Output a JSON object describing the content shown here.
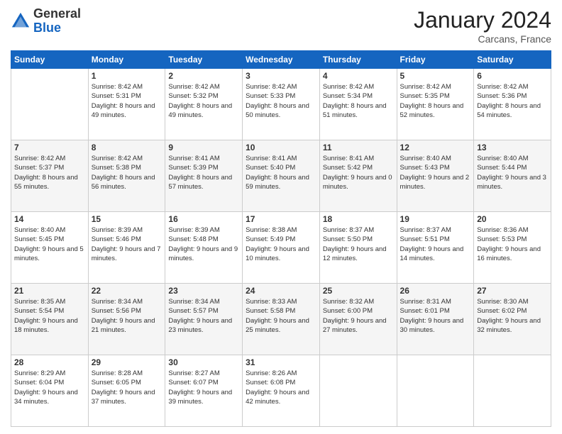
{
  "header": {
    "logo_line1": "General",
    "logo_line2": "Blue",
    "month": "January 2024",
    "location": "Carcans, France"
  },
  "weekdays": [
    "Sunday",
    "Monday",
    "Tuesday",
    "Wednesday",
    "Thursday",
    "Friday",
    "Saturday"
  ],
  "weeks": [
    [
      {
        "day": "",
        "sunrise": "",
        "sunset": "",
        "daylight": ""
      },
      {
        "day": "1",
        "sunrise": "Sunrise: 8:42 AM",
        "sunset": "Sunset: 5:31 PM",
        "daylight": "Daylight: 8 hours and 49 minutes."
      },
      {
        "day": "2",
        "sunrise": "Sunrise: 8:42 AM",
        "sunset": "Sunset: 5:32 PM",
        "daylight": "Daylight: 8 hours and 49 minutes."
      },
      {
        "day": "3",
        "sunrise": "Sunrise: 8:42 AM",
        "sunset": "Sunset: 5:33 PM",
        "daylight": "Daylight: 8 hours and 50 minutes."
      },
      {
        "day": "4",
        "sunrise": "Sunrise: 8:42 AM",
        "sunset": "Sunset: 5:34 PM",
        "daylight": "Daylight: 8 hours and 51 minutes."
      },
      {
        "day": "5",
        "sunrise": "Sunrise: 8:42 AM",
        "sunset": "Sunset: 5:35 PM",
        "daylight": "Daylight: 8 hours and 52 minutes."
      },
      {
        "day": "6",
        "sunrise": "Sunrise: 8:42 AM",
        "sunset": "Sunset: 5:36 PM",
        "daylight": "Daylight: 8 hours and 54 minutes."
      }
    ],
    [
      {
        "day": "7",
        "sunrise": "Sunrise: 8:42 AM",
        "sunset": "Sunset: 5:37 PM",
        "daylight": "Daylight: 8 hours and 55 minutes."
      },
      {
        "day": "8",
        "sunrise": "Sunrise: 8:42 AM",
        "sunset": "Sunset: 5:38 PM",
        "daylight": "Daylight: 8 hours and 56 minutes."
      },
      {
        "day": "9",
        "sunrise": "Sunrise: 8:41 AM",
        "sunset": "Sunset: 5:39 PM",
        "daylight": "Daylight: 8 hours and 57 minutes."
      },
      {
        "day": "10",
        "sunrise": "Sunrise: 8:41 AM",
        "sunset": "Sunset: 5:40 PM",
        "daylight": "Daylight: 8 hours and 59 minutes."
      },
      {
        "day": "11",
        "sunrise": "Sunrise: 8:41 AM",
        "sunset": "Sunset: 5:42 PM",
        "daylight": "Daylight: 9 hours and 0 minutes."
      },
      {
        "day": "12",
        "sunrise": "Sunrise: 8:40 AM",
        "sunset": "Sunset: 5:43 PM",
        "daylight": "Daylight: 9 hours and 2 minutes."
      },
      {
        "day": "13",
        "sunrise": "Sunrise: 8:40 AM",
        "sunset": "Sunset: 5:44 PM",
        "daylight": "Daylight: 9 hours and 3 minutes."
      }
    ],
    [
      {
        "day": "14",
        "sunrise": "Sunrise: 8:40 AM",
        "sunset": "Sunset: 5:45 PM",
        "daylight": "Daylight: 9 hours and 5 minutes."
      },
      {
        "day": "15",
        "sunrise": "Sunrise: 8:39 AM",
        "sunset": "Sunset: 5:46 PM",
        "daylight": "Daylight: 9 hours and 7 minutes."
      },
      {
        "day": "16",
        "sunrise": "Sunrise: 8:39 AM",
        "sunset": "Sunset: 5:48 PM",
        "daylight": "Daylight: 9 hours and 9 minutes."
      },
      {
        "day": "17",
        "sunrise": "Sunrise: 8:38 AM",
        "sunset": "Sunset: 5:49 PM",
        "daylight": "Daylight: 9 hours and 10 minutes."
      },
      {
        "day": "18",
        "sunrise": "Sunrise: 8:37 AM",
        "sunset": "Sunset: 5:50 PM",
        "daylight": "Daylight: 9 hours and 12 minutes."
      },
      {
        "day": "19",
        "sunrise": "Sunrise: 8:37 AM",
        "sunset": "Sunset: 5:51 PM",
        "daylight": "Daylight: 9 hours and 14 minutes."
      },
      {
        "day": "20",
        "sunrise": "Sunrise: 8:36 AM",
        "sunset": "Sunset: 5:53 PM",
        "daylight": "Daylight: 9 hours and 16 minutes."
      }
    ],
    [
      {
        "day": "21",
        "sunrise": "Sunrise: 8:35 AM",
        "sunset": "Sunset: 5:54 PM",
        "daylight": "Daylight: 9 hours and 18 minutes."
      },
      {
        "day": "22",
        "sunrise": "Sunrise: 8:34 AM",
        "sunset": "Sunset: 5:56 PM",
        "daylight": "Daylight: 9 hours and 21 minutes."
      },
      {
        "day": "23",
        "sunrise": "Sunrise: 8:34 AM",
        "sunset": "Sunset: 5:57 PM",
        "daylight": "Daylight: 9 hours and 23 minutes."
      },
      {
        "day": "24",
        "sunrise": "Sunrise: 8:33 AM",
        "sunset": "Sunset: 5:58 PM",
        "daylight": "Daylight: 9 hours and 25 minutes."
      },
      {
        "day": "25",
        "sunrise": "Sunrise: 8:32 AM",
        "sunset": "Sunset: 6:00 PM",
        "daylight": "Daylight: 9 hours and 27 minutes."
      },
      {
        "day": "26",
        "sunrise": "Sunrise: 8:31 AM",
        "sunset": "Sunset: 6:01 PM",
        "daylight": "Daylight: 9 hours and 30 minutes."
      },
      {
        "day": "27",
        "sunrise": "Sunrise: 8:30 AM",
        "sunset": "Sunset: 6:02 PM",
        "daylight": "Daylight: 9 hours and 32 minutes."
      }
    ],
    [
      {
        "day": "28",
        "sunrise": "Sunrise: 8:29 AM",
        "sunset": "Sunset: 6:04 PM",
        "daylight": "Daylight: 9 hours and 34 minutes."
      },
      {
        "day": "29",
        "sunrise": "Sunrise: 8:28 AM",
        "sunset": "Sunset: 6:05 PM",
        "daylight": "Daylight: 9 hours and 37 minutes."
      },
      {
        "day": "30",
        "sunrise": "Sunrise: 8:27 AM",
        "sunset": "Sunset: 6:07 PM",
        "daylight": "Daylight: 9 hours and 39 minutes."
      },
      {
        "day": "31",
        "sunrise": "Sunrise: 8:26 AM",
        "sunset": "Sunset: 6:08 PM",
        "daylight": "Daylight: 9 hours and 42 minutes."
      },
      {
        "day": "",
        "sunrise": "",
        "sunset": "",
        "daylight": ""
      },
      {
        "day": "",
        "sunrise": "",
        "sunset": "",
        "daylight": ""
      },
      {
        "day": "",
        "sunrise": "",
        "sunset": "",
        "daylight": ""
      }
    ]
  ]
}
